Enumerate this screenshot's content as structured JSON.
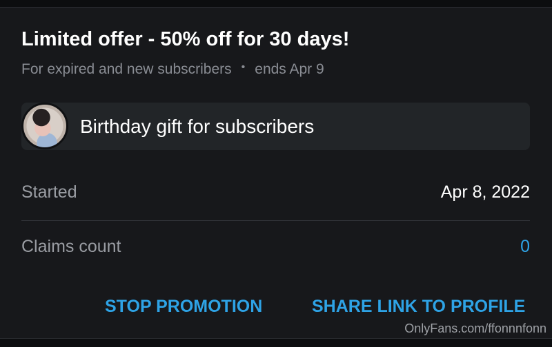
{
  "promotion": {
    "title": "Limited offer - 50% off for 30 days!",
    "audience": "For expired and new subscribers",
    "separator": "•",
    "ends": "ends Apr 9",
    "gift_label": "Birthday gift for subscribers",
    "avatar_icon": "profile-photo"
  },
  "details": {
    "started_label": "Started",
    "started_value": "Apr 8, 2022",
    "claims_label": "Claims count",
    "claims_value": "0"
  },
  "actions": {
    "stop_label": "STOP PROMOTION",
    "share_label": "SHARE LINK TO PROFILE"
  },
  "watermark": "OnlyFans.com/ffonnnfonn",
  "colors": {
    "accent": "#2ea3e6",
    "card_bg": "#17181b",
    "page_bg": "#0c0d0f"
  }
}
